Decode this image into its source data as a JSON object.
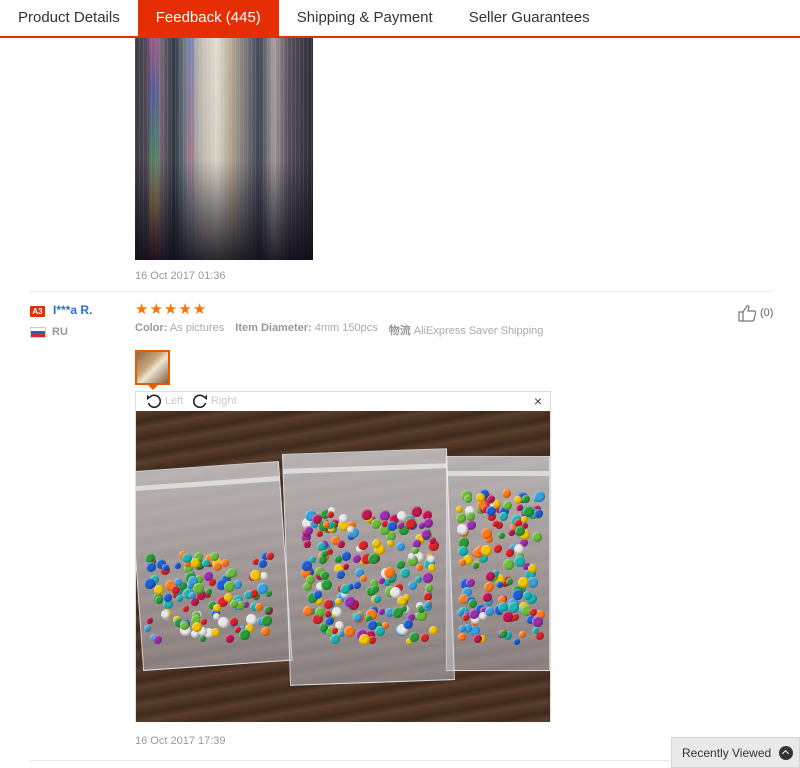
{
  "tabs": [
    {
      "label": "Product Details",
      "active": false
    },
    {
      "label": "Feedback (445)",
      "active": true
    },
    {
      "label": "Shipping & Payment",
      "active": false
    },
    {
      "label": "Seller Guarantees",
      "active": false
    }
  ],
  "previous_review": {
    "date": "16 Oct 2017 01:36"
  },
  "review": {
    "level_badge": "A3",
    "user_name": "I***a R.",
    "country": "RU",
    "rating": 5,
    "attributes": [
      {
        "label": "Color:",
        "value": "As pictures"
      },
      {
        "label": "Item Diameter:",
        "value": "4mm 150pcs"
      },
      {
        "label": "物流",
        "value": "AliExpress Saver Shipping"
      }
    ],
    "helpful_count": "(0)",
    "viewer": {
      "rotate_left_label": "Left",
      "rotate_right_label": "Right",
      "close_label": "×"
    },
    "date": "16 Oct 2017 17:39"
  },
  "recently_viewed": {
    "label": "Recently Viewed"
  },
  "colors": {
    "accent": "#e62e04",
    "star": "#ff7200",
    "link": "#2a6fd6"
  }
}
